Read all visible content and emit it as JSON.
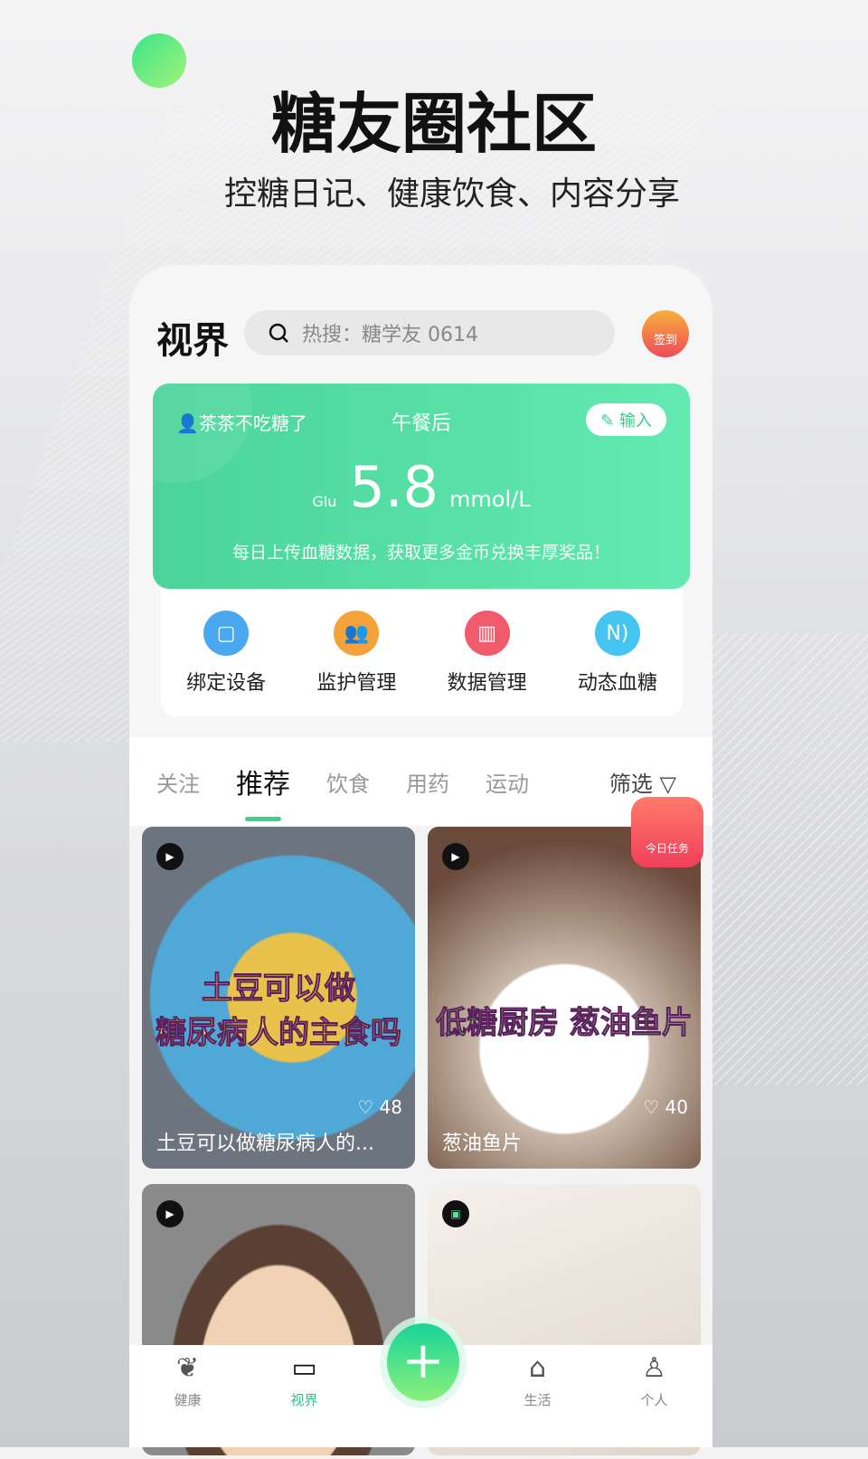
{
  "promo": {
    "title": "糖友圈社区",
    "subtitle": "控糖日记、健康饮食、内容分享"
  },
  "header": {
    "title": "视界",
    "search_placeholder": "热搜：糖学友 0614",
    "sign_in": "签到"
  },
  "glucose": {
    "user": "茶茶不吃糖了",
    "meal": "午餐后",
    "input_label": "输入",
    "icon_text": "Glu",
    "value": "5.8",
    "unit": "mmol/L",
    "tip": "每日上传血糖数据，获取更多金币兑换丰厚奖品！",
    "colors": {
      "start": "#4bd49a",
      "end": "#62eab0"
    }
  },
  "quick": [
    {
      "label": "绑定设备",
      "icon": "device-icon",
      "color": "#4aa8f0"
    },
    {
      "label": "监护管理",
      "icon": "users-icon",
      "color": "#f5a23a"
    },
    {
      "label": "数据管理",
      "icon": "chart-icon",
      "color": "#f05a6a"
    },
    {
      "label": "动态血糖",
      "icon": "nfc-icon",
      "color": "#45c6f2"
    }
  ],
  "tabs": [
    {
      "label": "关注"
    },
    {
      "label": "推荐",
      "active": true
    },
    {
      "label": "饮食"
    },
    {
      "label": "用药"
    },
    {
      "label": "运动"
    }
  ],
  "filter_label": "筛选",
  "task_label": "今日任务",
  "posts": [
    {
      "caption": "土豆可以做糖尿病人的...",
      "likes": "48",
      "overlay": "土豆可以做\n糖尿病人的主食吗",
      "type": "video"
    },
    {
      "caption": "葱油鱼片",
      "likes": "40",
      "overlay": "低糖厨房 葱油鱼片",
      "type": "video"
    },
    {
      "caption": "",
      "type": "video"
    },
    {
      "caption": "",
      "type": "image"
    }
  ],
  "nav": [
    {
      "label": "健康",
      "icon": "leaf-icon"
    },
    {
      "label": "视界",
      "icon": "video-camera-icon",
      "active": true
    },
    {
      "label": "生活",
      "icon": "shop-icon"
    },
    {
      "label": "个人",
      "icon": "person-icon"
    }
  ]
}
